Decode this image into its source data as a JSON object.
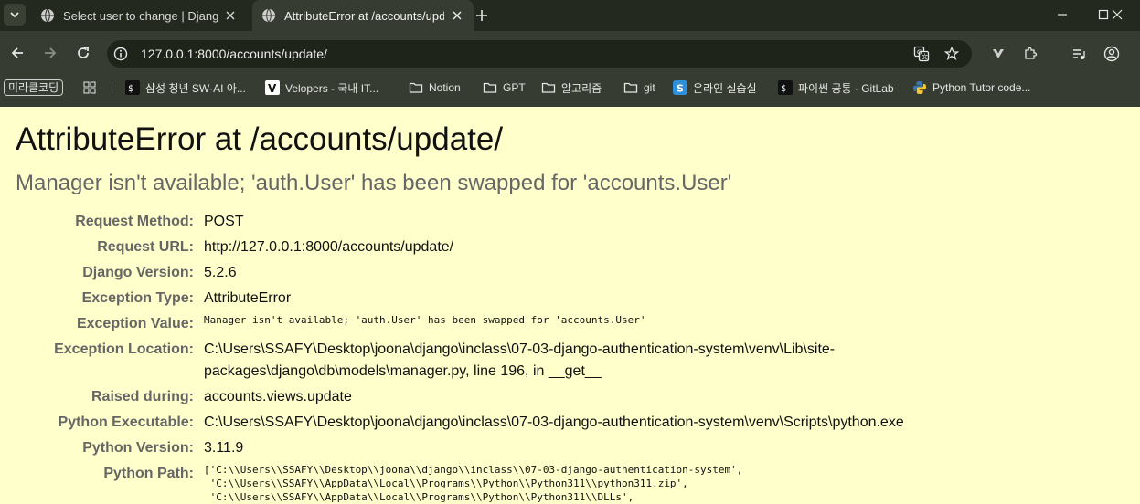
{
  "browser": {
    "tabs": [
      {
        "title": "Select user to change | Django",
        "active": false
      },
      {
        "title": "AttributeError at /accounts/update",
        "active": true
      }
    ],
    "url": "127.0.0.1:8000/accounts/update/",
    "bookmarks": [
      {
        "label": "미라클코딩",
        "icon": "pill-label"
      },
      {
        "label": "",
        "icon": "grid-icon"
      },
      {
        "label": "삼성 청년 SW·AI 아...",
        "icon": "terminal-icon"
      },
      {
        "label": "Velopers - 국내 IT...",
        "icon": "velopers-icon"
      },
      {
        "label": "Notion",
        "icon": "folder-icon"
      },
      {
        "label": "GPT",
        "icon": "folder-icon"
      },
      {
        "label": "알고리즘",
        "icon": "folder-icon"
      },
      {
        "label": "git",
        "icon": "folder-icon"
      },
      {
        "label": "온라인 실습실",
        "icon": "s-icon"
      },
      {
        "label": "파이썬 공통 · GitLab",
        "icon": "terminal-icon"
      },
      {
        "label": "Python Tutor code...",
        "icon": "python-icon"
      }
    ]
  },
  "page": {
    "title": "AttributeError at /accounts/update/",
    "subtitle": "Manager isn't available; 'auth.User' has been swapped for 'accounts.User'",
    "meta": [
      {
        "label": "Request Method:",
        "value": "POST"
      },
      {
        "label": "Request URL:",
        "value": "http://127.0.0.1:8000/accounts/update/"
      },
      {
        "label": "Django Version:",
        "value": "5.2.6"
      },
      {
        "label": "Exception Type:",
        "value": "AttributeError"
      },
      {
        "label": "Exception Value:",
        "value": "Manager isn't available; 'auth.User' has been swapped for 'accounts.User'"
      },
      {
        "label": "Exception Location:",
        "value": "C:\\Users\\SSAFY\\Desktop\\joona\\django\\inclass\\07-03-django-authentication-system\\venv\\Lib\\site-packages\\django\\db\\models\\manager.py, line 196, in __get__"
      },
      {
        "label": "Raised during:",
        "value": "accounts.views.update"
      },
      {
        "label": "Python Executable:",
        "value": "C:\\Users\\SSAFY\\Desktop\\joona\\django\\inclass\\07-03-django-authentication-system\\venv\\Scripts\\python.exe"
      },
      {
        "label": "Python Version:",
        "value": "3.11.9"
      },
      {
        "label": "Python Path:",
        "value_lines": [
          "['C:\\\\Users\\\\SSAFY\\\\Desktop\\\\joona\\\\django\\\\inclass\\\\07-03-django-authentication-system',",
          " 'C:\\\\Users\\\\SSAFY\\\\AppData\\\\Local\\\\Programs\\\\Python\\\\Python311\\\\python311.zip',",
          " 'C:\\\\Users\\\\SSAFY\\\\AppData\\\\Local\\\\Programs\\\\Python\\\\Python311\\\\DLLs',"
        ]
      }
    ]
  },
  "colors": {
    "page_bg": "#ffffcc",
    "label": "#666666",
    "chrome_bg": "#363c31",
    "tabstrip_bg": "#23291f"
  }
}
